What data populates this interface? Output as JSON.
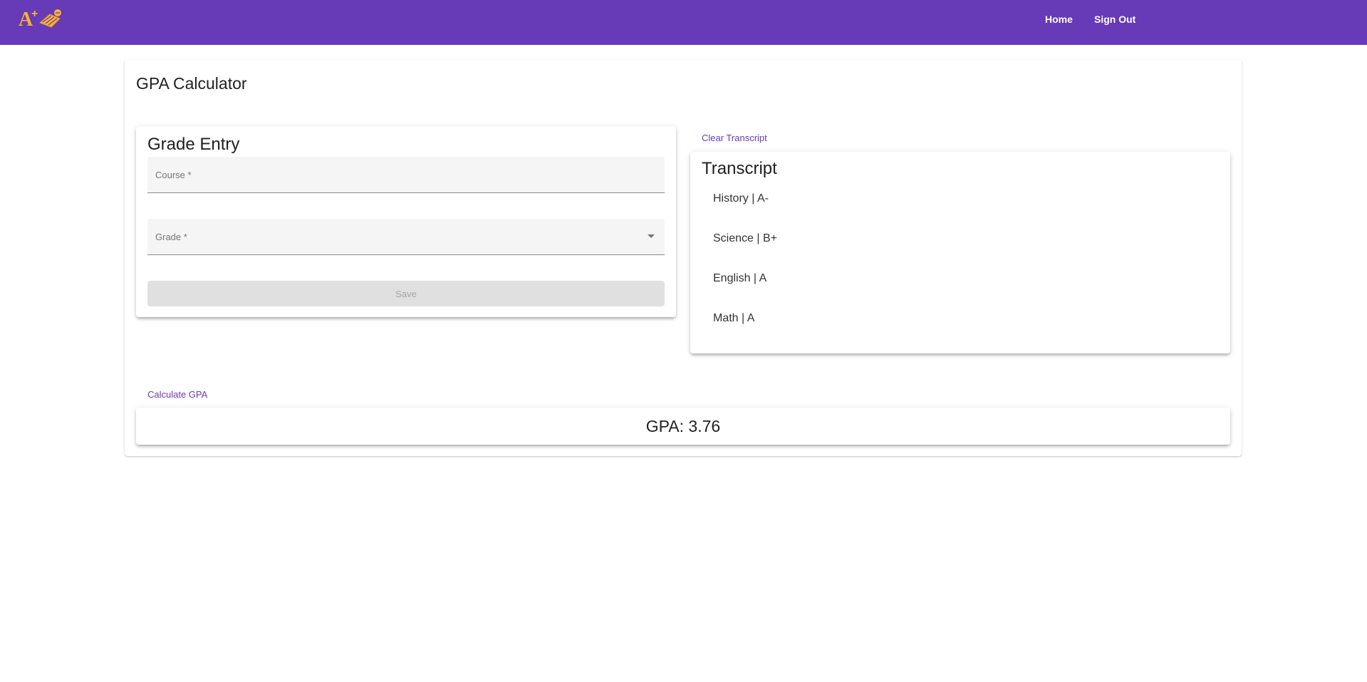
{
  "brand": {
    "logo_text": "A+",
    "logo_color": "#f9b233"
  },
  "nav": {
    "home": "Home",
    "sign_out": "Sign Out"
  },
  "colors": {
    "primary": "#673ab7",
    "accent_text": "#673ab7",
    "disabled_button": "#e0e0e0"
  },
  "page": {
    "title": "GPA Calculator"
  },
  "grade_entry": {
    "title": "Grade Entry",
    "course_label": "Course *",
    "course_value": "",
    "grade_label": "Grade *",
    "grade_value": "",
    "save_label": "Save",
    "save_disabled": true
  },
  "transcript": {
    "clear_label": "Clear Transcript",
    "title": "Transcript",
    "items": [
      "History | A-",
      "Science | B+",
      "English | A",
      "Math | A"
    ]
  },
  "gpa": {
    "calculate_label": "Calculate GPA",
    "result": "GPA: 3.76"
  }
}
